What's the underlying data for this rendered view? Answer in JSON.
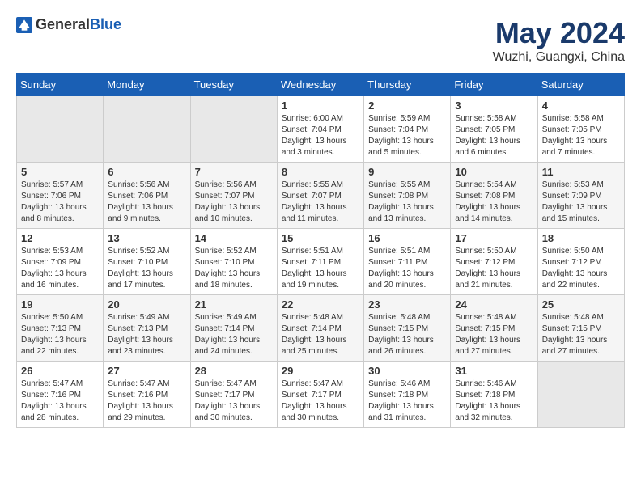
{
  "header": {
    "logo_general": "General",
    "logo_blue": "Blue",
    "month": "May 2024",
    "location": "Wuzhi, Guangxi, China"
  },
  "weekdays": [
    "Sunday",
    "Monday",
    "Tuesday",
    "Wednesday",
    "Thursday",
    "Friday",
    "Saturday"
  ],
  "weeks": [
    [
      {
        "day": "",
        "empty": true
      },
      {
        "day": "",
        "empty": true
      },
      {
        "day": "",
        "empty": true
      },
      {
        "day": "1",
        "sunrise": "6:00 AM",
        "sunset": "7:04 PM",
        "daylight": "13 hours and 3 minutes."
      },
      {
        "day": "2",
        "sunrise": "5:59 AM",
        "sunset": "7:04 PM",
        "daylight": "13 hours and 5 minutes."
      },
      {
        "day": "3",
        "sunrise": "5:58 AM",
        "sunset": "7:05 PM",
        "daylight": "13 hours and 6 minutes."
      },
      {
        "day": "4",
        "sunrise": "5:58 AM",
        "sunset": "7:05 PM",
        "daylight": "13 hours and 7 minutes."
      }
    ],
    [
      {
        "day": "5",
        "sunrise": "5:57 AM",
        "sunset": "7:06 PM",
        "daylight": "13 hours and 8 minutes."
      },
      {
        "day": "6",
        "sunrise": "5:56 AM",
        "sunset": "7:06 PM",
        "daylight": "13 hours and 9 minutes."
      },
      {
        "day": "7",
        "sunrise": "5:56 AM",
        "sunset": "7:07 PM",
        "daylight": "13 hours and 10 minutes."
      },
      {
        "day": "8",
        "sunrise": "5:55 AM",
        "sunset": "7:07 PM",
        "daylight": "13 hours and 11 minutes."
      },
      {
        "day": "9",
        "sunrise": "5:55 AM",
        "sunset": "7:08 PM",
        "daylight": "13 hours and 13 minutes."
      },
      {
        "day": "10",
        "sunrise": "5:54 AM",
        "sunset": "7:08 PM",
        "daylight": "13 hours and 14 minutes."
      },
      {
        "day": "11",
        "sunrise": "5:53 AM",
        "sunset": "7:09 PM",
        "daylight": "13 hours and 15 minutes."
      }
    ],
    [
      {
        "day": "12",
        "sunrise": "5:53 AM",
        "sunset": "7:09 PM",
        "daylight": "13 hours and 16 minutes."
      },
      {
        "day": "13",
        "sunrise": "5:52 AM",
        "sunset": "7:10 PM",
        "daylight": "13 hours and 17 minutes."
      },
      {
        "day": "14",
        "sunrise": "5:52 AM",
        "sunset": "7:10 PM",
        "daylight": "13 hours and 18 minutes."
      },
      {
        "day": "15",
        "sunrise": "5:51 AM",
        "sunset": "7:11 PM",
        "daylight": "13 hours and 19 minutes."
      },
      {
        "day": "16",
        "sunrise": "5:51 AM",
        "sunset": "7:11 PM",
        "daylight": "13 hours and 20 minutes."
      },
      {
        "day": "17",
        "sunrise": "5:50 AM",
        "sunset": "7:12 PM",
        "daylight": "13 hours and 21 minutes."
      },
      {
        "day": "18",
        "sunrise": "5:50 AM",
        "sunset": "7:12 PM",
        "daylight": "13 hours and 22 minutes."
      }
    ],
    [
      {
        "day": "19",
        "sunrise": "5:50 AM",
        "sunset": "7:13 PM",
        "daylight": "13 hours and 22 minutes."
      },
      {
        "day": "20",
        "sunrise": "5:49 AM",
        "sunset": "7:13 PM",
        "daylight": "13 hours and 23 minutes."
      },
      {
        "day": "21",
        "sunrise": "5:49 AM",
        "sunset": "7:14 PM",
        "daylight": "13 hours and 24 minutes."
      },
      {
        "day": "22",
        "sunrise": "5:48 AM",
        "sunset": "7:14 PM",
        "daylight": "13 hours and 25 minutes."
      },
      {
        "day": "23",
        "sunrise": "5:48 AM",
        "sunset": "7:15 PM",
        "daylight": "13 hours and 26 minutes."
      },
      {
        "day": "24",
        "sunrise": "5:48 AM",
        "sunset": "7:15 PM",
        "daylight": "13 hours and 27 minutes."
      },
      {
        "day": "25",
        "sunrise": "5:48 AM",
        "sunset": "7:15 PM",
        "daylight": "13 hours and 27 minutes."
      }
    ],
    [
      {
        "day": "26",
        "sunrise": "5:47 AM",
        "sunset": "7:16 PM",
        "daylight": "13 hours and 28 minutes."
      },
      {
        "day": "27",
        "sunrise": "5:47 AM",
        "sunset": "7:16 PM",
        "daylight": "13 hours and 29 minutes."
      },
      {
        "day": "28",
        "sunrise": "5:47 AM",
        "sunset": "7:17 PM",
        "daylight": "13 hours and 30 minutes."
      },
      {
        "day": "29",
        "sunrise": "5:47 AM",
        "sunset": "7:17 PM",
        "daylight": "13 hours and 30 minutes."
      },
      {
        "day": "30",
        "sunrise": "5:46 AM",
        "sunset": "7:18 PM",
        "daylight": "13 hours and 31 minutes."
      },
      {
        "day": "31",
        "sunrise": "5:46 AM",
        "sunset": "7:18 PM",
        "daylight": "13 hours and 32 minutes."
      },
      {
        "day": "",
        "empty": true
      }
    ]
  ],
  "daylight_label": "Daylight:",
  "sunrise_label": "Sunrise:",
  "sunset_label": "Sunset:"
}
